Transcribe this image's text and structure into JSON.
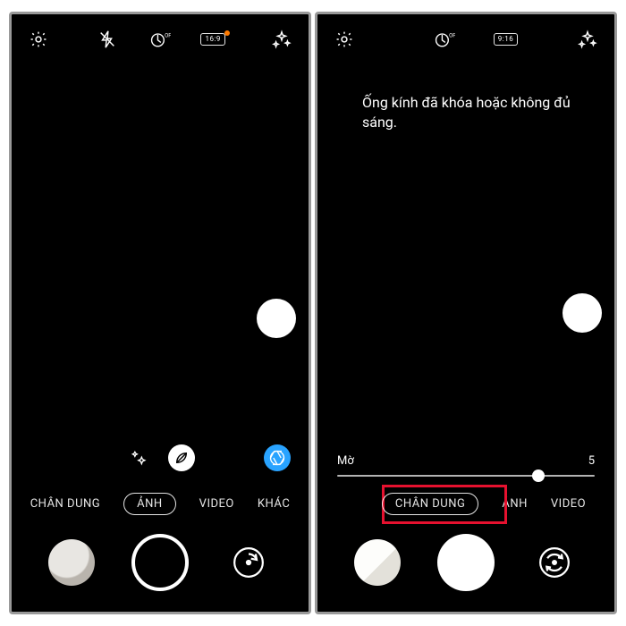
{
  "left": {
    "top": {
      "ratio": "16:9"
    },
    "modes": {
      "portrait": "CHÂN DUNG",
      "photo": "ẢNH",
      "video": "VIDEO",
      "more": "KHÁC"
    },
    "focusDotTop": "262px"
  },
  "right": {
    "top": {
      "ratio": "9:16"
    },
    "message": "Ống kính đã khóa hoặc không đủ sáng.",
    "slider": {
      "leftLabel": "Mờ",
      "rightLabel": "5",
      "percent": 78
    },
    "modes": {
      "portrait": "CHÂN DUNG",
      "photo": "ẢNH",
      "video": "VIDEO"
    },
    "focusDotTop": "256px"
  }
}
